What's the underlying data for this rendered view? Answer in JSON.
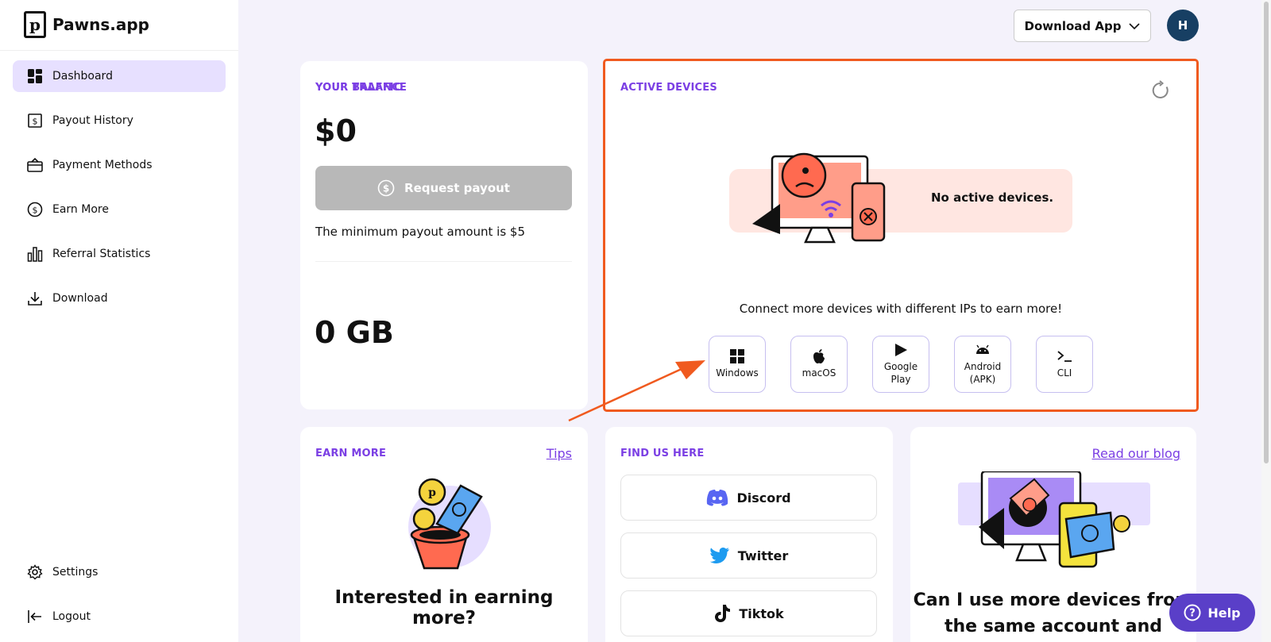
{
  "app": {
    "title": "Pawns.app"
  },
  "sidebar": {
    "items": [
      {
        "label": "Dashboard",
        "icon": "dashboard-icon",
        "active": true
      },
      {
        "label": "Payout History",
        "icon": "dollar-receipt-icon"
      },
      {
        "label": "Payment Methods",
        "icon": "card-icon"
      },
      {
        "label": "Earn More",
        "icon": "dollar-circle-icon"
      },
      {
        "label": "Referral Statistics",
        "icon": "bar-chart-icon"
      },
      {
        "label": "Download",
        "icon": "download-icon"
      }
    ],
    "bottom": [
      {
        "label": "Settings",
        "icon": "gear-icon"
      },
      {
        "label": "Logout",
        "icon": "logout-icon"
      }
    ]
  },
  "header": {
    "download_label": "Download App",
    "avatar_initial": "H"
  },
  "balance": {
    "label": "YOUR BALANCE",
    "amount": "$0",
    "payout_label": "Request payout",
    "min_note": "The minimum payout amount is $5",
    "traffic_label": "YOUR TRAFFIC",
    "traffic_amount": "0 GB"
  },
  "devices": {
    "label": "ACTIVE DEVICES",
    "empty_text": "No active devices.",
    "connect_msg": "Connect more devices with different IPs to earn more!",
    "platforms": [
      {
        "label": "Windows",
        "icon": "windows-icon"
      },
      {
        "label": "macOS",
        "icon": "apple-icon"
      },
      {
        "label": "Google Play",
        "icon": "play-icon"
      },
      {
        "label": "Android (APK)",
        "icon": "android-icon"
      },
      {
        "label": "CLI",
        "icon": "terminal-icon"
      }
    ]
  },
  "earn": {
    "label": "EARN MORE",
    "tips": "Tips",
    "title": "Interested in earning more?"
  },
  "social": {
    "label": "FIND US HERE",
    "links": [
      {
        "label": "Discord",
        "icon": "discord-icon"
      },
      {
        "label": "Twitter",
        "icon": "twitter-icon"
      },
      {
        "label": "Tiktok",
        "icon": "tiktok-icon"
      }
    ]
  },
  "blog": {
    "link": "Read our blog",
    "title": "Can I use more devices from the same account and"
  },
  "help": {
    "label": "Help"
  },
  "colors": {
    "accent": "#7b3fe4",
    "highlight": "#f05a1f",
    "avatar": "#173f63",
    "help": "#5a3fc8"
  }
}
